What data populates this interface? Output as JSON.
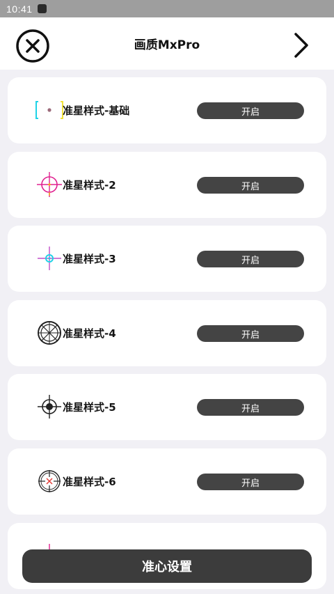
{
  "status_bar": {
    "time": "10:41"
  },
  "header": {
    "title": "画质MxPro"
  },
  "crosshairs": [
    {
      "label": "准星样式-基础",
      "button": "开启",
      "icon": "crosshair-basic-icon"
    },
    {
      "label": "准星样式-2",
      "button": "开启",
      "icon": "crosshair-circle-pink-icon"
    },
    {
      "label": "准星样式-3",
      "button": "开启",
      "icon": "crosshair-cross-cyan-icon"
    },
    {
      "label": "准星样式-4",
      "button": "开启",
      "icon": "crosshair-scope-icon"
    },
    {
      "label": "准星样式-5",
      "button": "开启",
      "icon": "crosshair-dot-scope-icon"
    },
    {
      "label": "准星样式-6",
      "button": "开启",
      "icon": "crosshair-red-scope-icon"
    }
  ],
  "footer": {
    "button": "准心设置"
  },
  "colors": {
    "background": "#f1f0f5",
    "card": "#ffffff",
    "button": "#444444",
    "status_bar": "#9e9e9e",
    "accent_pink": "#e0208f",
    "accent_cyan": "#1fd3e6",
    "accent_yellow": "#f2e23a"
  }
}
